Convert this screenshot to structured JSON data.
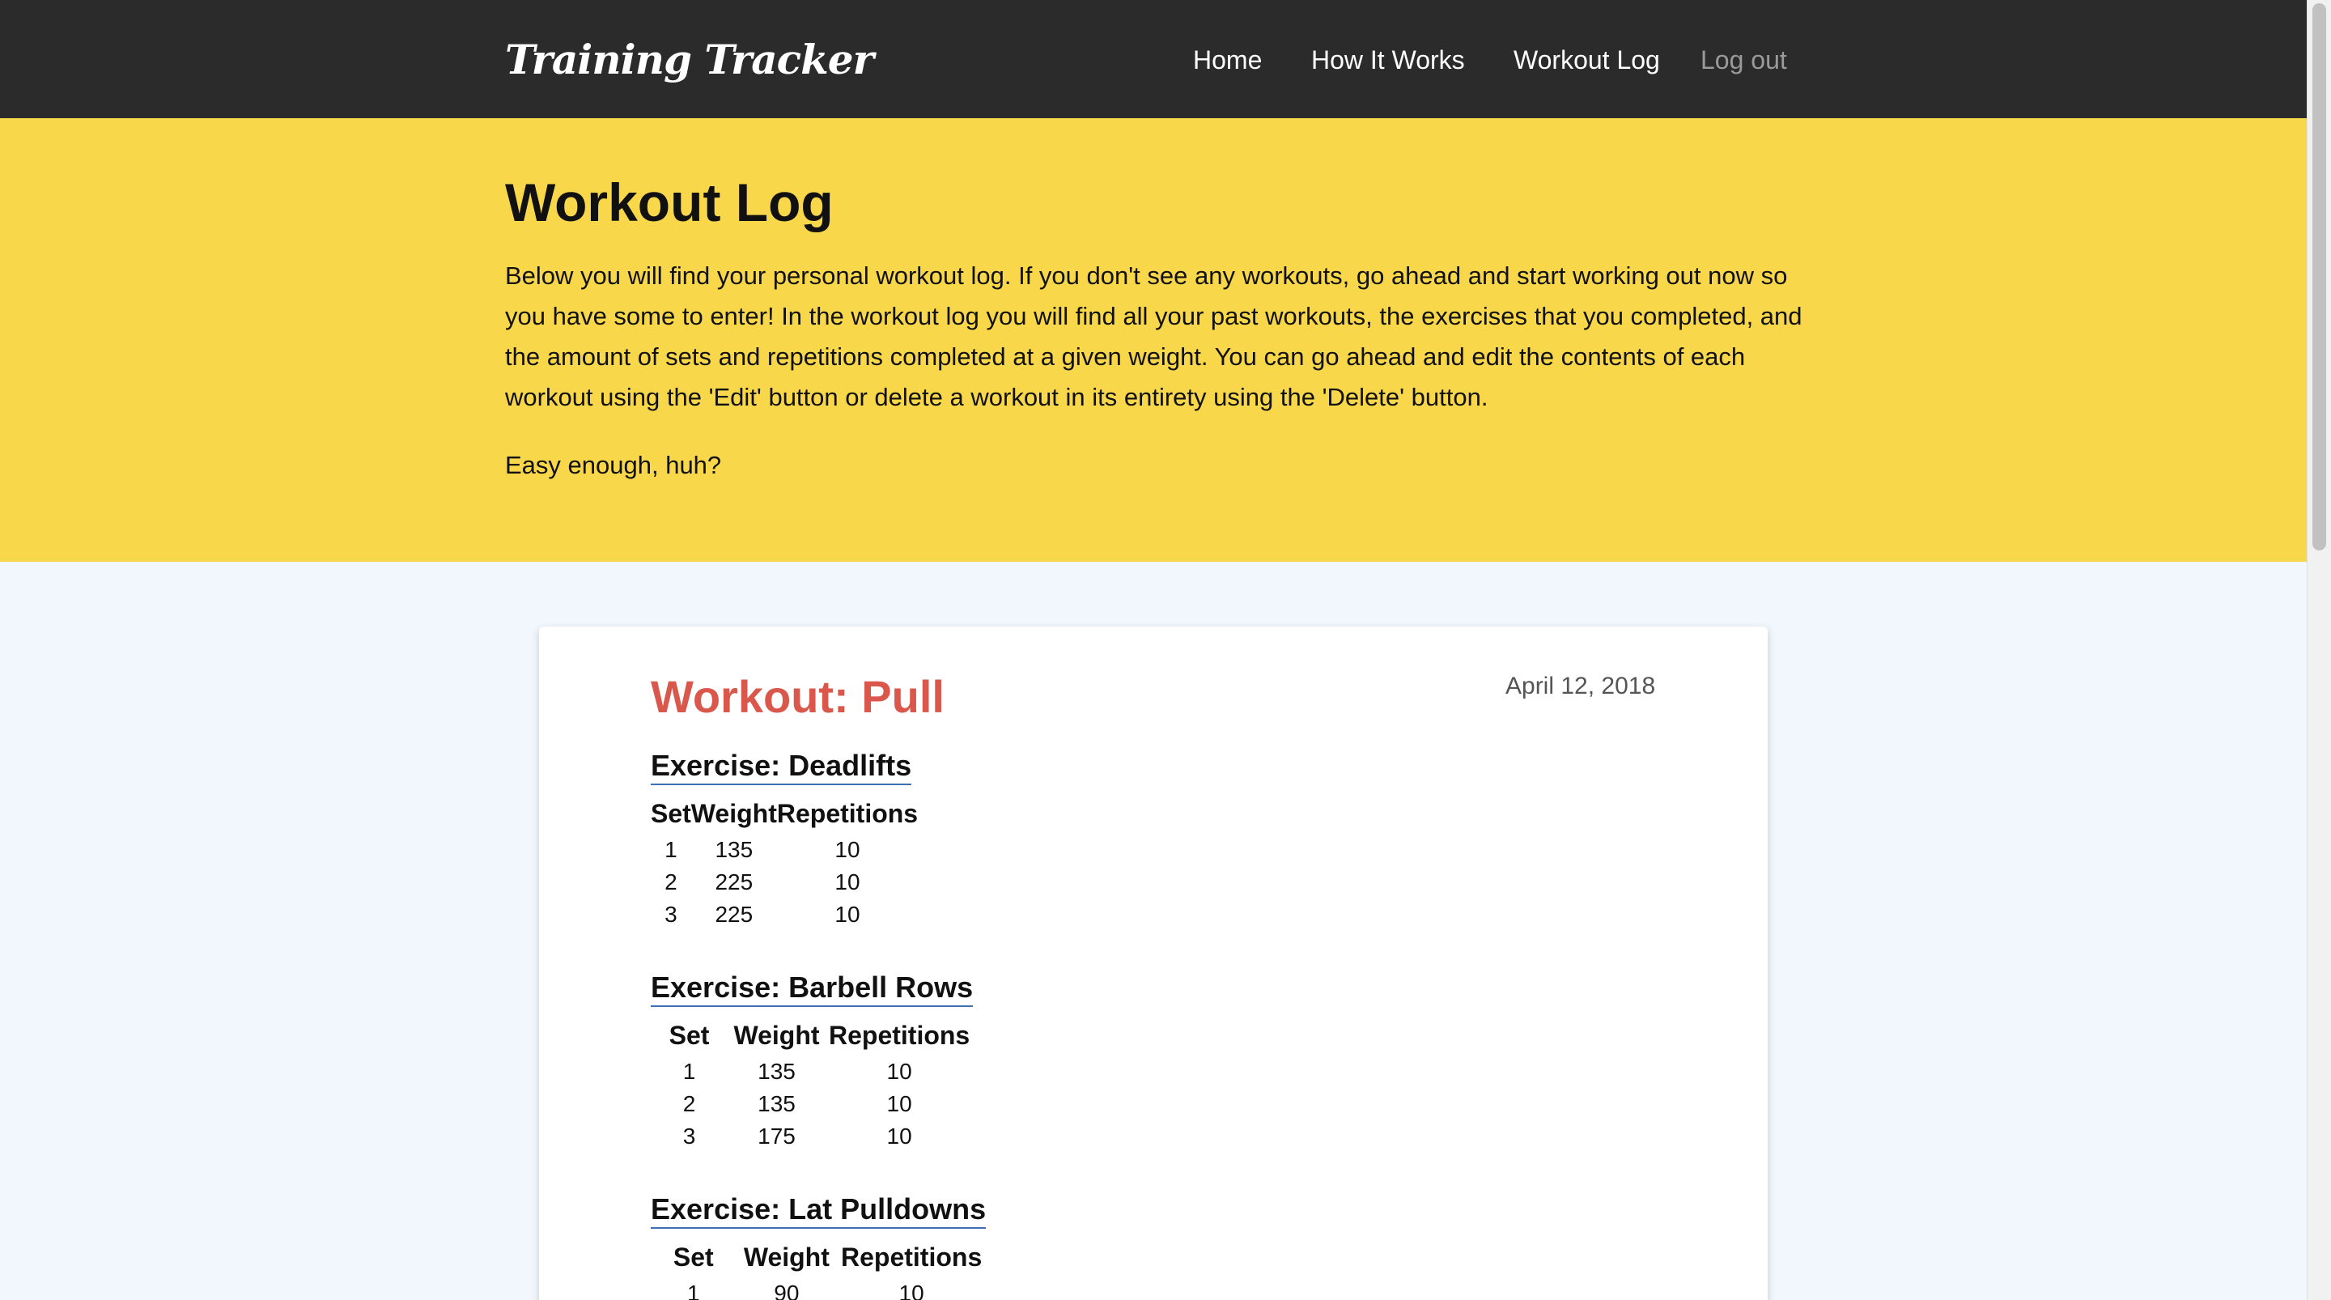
{
  "navbar": {
    "brand": "Training Tracker",
    "links": [
      "Home",
      "How It Works",
      "Workout Log"
    ],
    "logout": "Log out"
  },
  "hero": {
    "title": "Workout Log",
    "paragraph": "Below you will find your personal workout log. If you don't see any workouts, go ahead and start working out now so you have some to enter! In the workout log you will find all your past workouts, the exercises that you completed, and the amount of sets and repetitions completed at a given weight. You can go ahead and edit the contents of each workout using the 'Edit' button or delete a workout in its entirety using the 'Delete' button.",
    "paragraph2": "Easy enough, huh?"
  },
  "workout": {
    "title": "Workout: Pull",
    "date": "April 12, 2018",
    "headers": [
      "Set",
      "Weight",
      "Repetitions"
    ],
    "exercises": [
      {
        "title": "Exercise: Deadlifts",
        "rows": [
          [
            "1",
            "135",
            "10"
          ],
          [
            "2",
            "225",
            "10"
          ],
          [
            "3",
            "225",
            "10"
          ]
        ]
      },
      {
        "title": "Exercise: Barbell Rows",
        "rows": [
          [
            "1",
            "135",
            "10"
          ],
          [
            "2",
            "135",
            "10"
          ],
          [
            "3",
            "175",
            "10"
          ]
        ]
      },
      {
        "title": "Exercise: Lat Pulldowns",
        "rows": [
          [
            "1",
            "90",
            "10"
          ]
        ]
      }
    ]
  }
}
